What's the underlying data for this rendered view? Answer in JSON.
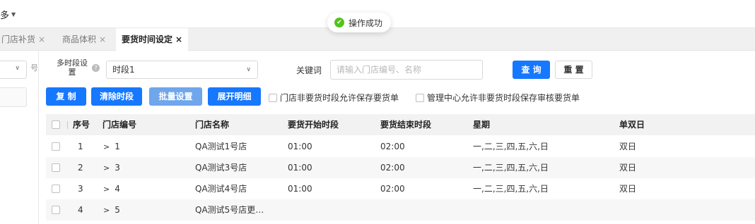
{
  "app": {
    "more_menu": "多",
    "toast": "操作成功"
  },
  "tabs": [
    {
      "label": "门店补货",
      "close": "×"
    },
    {
      "label": "商品体积",
      "close": "×"
    },
    {
      "label": "要货时间设定",
      "close": "×",
      "active": true
    }
  ],
  "sidebar": {
    "truncated_char": "号"
  },
  "filters": {
    "period_label": "多时段设置",
    "period_value": "时段1",
    "keyword_label": "关键词",
    "keyword_placeholder": "请输入门店编号、名称",
    "query_button": "查 询",
    "reset_button": "重 置"
  },
  "toolbar": {
    "copy_button": "复 制",
    "clear_button": "清除时段",
    "batch_button": "批量设置",
    "expand_button": "展开明细",
    "option1": "门店非要货时段允许保存要货单",
    "option2": "管理中心允许非要货时段保存审核要货单"
  },
  "table": {
    "columns": [
      "序号",
      "门店编号",
      "门店名称",
      "要货开始时段",
      "要货结束时段",
      "星期",
      "单双日"
    ],
    "rows": [
      {
        "index": "1",
        "code": "1",
        "name": "QA测试1号店",
        "start": "01:00",
        "end": "02:00",
        "week": "一,二,三,四,五,六,日",
        "day": "双日"
      },
      {
        "index": "2",
        "code": "3",
        "name": "QA测试3号店",
        "start": "01:00",
        "end": "02:00",
        "week": "一,二,三,四,五,六,日",
        "day": "双日"
      },
      {
        "index": "3",
        "code": "4",
        "name": "QA测试4号店",
        "start": "01:00",
        "end": "02:00",
        "week": "一,二,三,四,五,六,日",
        "day": "双日"
      },
      {
        "index": "4",
        "code": "5",
        "name": "QA测试5号店更…",
        "start": "",
        "end": "",
        "week": "",
        "day": ""
      }
    ]
  },
  "colors": {
    "primary": "#1677ff",
    "primary_light": "#6fa6ec",
    "success": "#52c41a"
  }
}
